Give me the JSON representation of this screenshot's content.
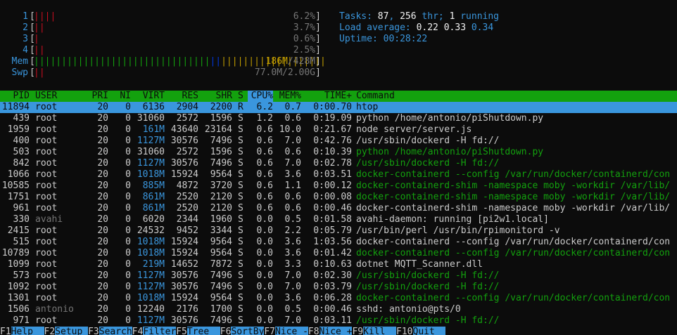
{
  "meters": {
    "cpus": [
      {
        "label": "1",
        "bars_red": "||||",
        "bars_green": "",
        "value": "6.2%"
      },
      {
        "label": "2",
        "bars_red": "||",
        "bars_green": "",
        "value": "3.7%"
      },
      {
        "label": "3",
        "bars_red": "|",
        "bars_green": "",
        "value": "0.6%"
      },
      {
        "label": "4",
        "bars_red": "||",
        "bars_green": "",
        "value": "2.5%"
      }
    ],
    "mem": {
      "label": "Mem",
      "bars_green": "||||||||||||||||||||||||||||||||",
      "bars_blue": "||",
      "bars_yellow": "|||||||||||||||||||",
      "value_used": "186M",
      "value_total": "/428M"
    },
    "swp": {
      "label": "Swp",
      "bars_red": "||",
      "value": "77.0M/2.00G"
    }
  },
  "summary": {
    "tasks_label": "Tasks: ",
    "tasks_count": "87",
    "tasks_sep": ", ",
    "threads": "256",
    "threads_label": " thr; ",
    "running": "1",
    "running_label": " running",
    "load_label": "Load average: ",
    "load1": "0.22",
    "load5": "0.33",
    "load15": "0.34",
    "uptime_label": "Uptime: ",
    "uptime": "00:28:22"
  },
  "columns": {
    "pid": "PID",
    "user": "USER",
    "pri": "PRI",
    "ni": "NI",
    "virt": "VIRT",
    "res": "RES",
    "shr": "SHR",
    "s": "S",
    "cpu": "CPU%",
    "mem": "MEM%",
    "time": "TIME+",
    "command": "Command"
  },
  "processes": [
    {
      "pid": "11894",
      "user": "root",
      "pri": "20",
      "ni": "0",
      "virt": "6136",
      "res": "2904",
      "shr": "2200",
      "s": "R",
      "cpu": "6.2",
      "mem": "0.7",
      "time": "0:00.70",
      "command": "htop",
      "kind": "sel"
    },
    {
      "pid": "439",
      "user": "root",
      "pri": "20",
      "ni": "0",
      "virt": "31060",
      "res": "2572",
      "shr": "1596",
      "s": "S",
      "cpu": "1.2",
      "mem": "0.6",
      "time": "0:19.09",
      "command": "python /home/antonio/piShutdown.py",
      "kind": "proc"
    },
    {
      "pid": "1959",
      "user": "root",
      "pri": "20",
      "ni": "0",
      "virt": "161M",
      "res": "43640",
      "shr": "23164",
      "s": "S",
      "cpu": "0.6",
      "mem": "10.0",
      "time": "0:21.67",
      "command": "node server/server.js",
      "kind": "proc"
    },
    {
      "pid": "400",
      "user": "root",
      "pri": "20",
      "ni": "0",
      "virt": "1127M",
      "res": "30576",
      "shr": "7496",
      "s": "S",
      "cpu": "0.6",
      "mem": "7.0",
      "time": "0:42.76",
      "command": "/usr/sbin/dockerd -H fd://",
      "kind": "proc"
    },
    {
      "pid": "503",
      "user": "root",
      "pri": "20",
      "ni": "0",
      "virt": "31060",
      "res": "2572",
      "shr": "1596",
      "s": "S",
      "cpu": "0.6",
      "mem": "0.6",
      "time": "0:10.39",
      "command": "python /home/antonio/piShutdown.py",
      "kind": "thread"
    },
    {
      "pid": "842",
      "user": "root",
      "pri": "20",
      "ni": "0",
      "virt": "1127M",
      "res": "30576",
      "shr": "7496",
      "s": "S",
      "cpu": "0.6",
      "mem": "7.0",
      "time": "0:02.78",
      "command": "/usr/sbin/dockerd -H fd://",
      "kind": "thread"
    },
    {
      "pid": "1066",
      "user": "root",
      "pri": "20",
      "ni": "0",
      "virt": "1018M",
      "res": "15924",
      "shr": "9564",
      "s": "S",
      "cpu": "0.6",
      "mem": "3.6",
      "time": "0:03.51",
      "command": "docker-containerd --config /var/run/docker/containerd/con",
      "kind": "thread"
    },
    {
      "pid": "10585",
      "user": "root",
      "pri": "20",
      "ni": "0",
      "virt": "885M",
      "res": "4872",
      "shr": "3720",
      "s": "S",
      "cpu": "0.6",
      "mem": "1.1",
      "time": "0:00.12",
      "command": "docker-containerd-shim -namespace moby -workdir /var/lib/",
      "kind": "thread"
    },
    {
      "pid": "1751",
      "user": "root",
      "pri": "20",
      "ni": "0",
      "virt": "861M",
      "res": "2520",
      "shr": "2120",
      "s": "S",
      "cpu": "0.6",
      "mem": "0.6",
      "time": "0:00.08",
      "command": "docker-containerd-shim -namespace moby -workdir /var/lib/",
      "kind": "thread"
    },
    {
      "pid": "961",
      "user": "root",
      "pri": "20",
      "ni": "0",
      "virt": "861M",
      "res": "2520",
      "shr": "2120",
      "s": "S",
      "cpu": "0.6",
      "mem": "0.6",
      "time": "0:00.46",
      "command": "docker-containerd-shim -namespace moby -workdir /var/lib/",
      "kind": "proc"
    },
    {
      "pid": "330",
      "user": "avahi",
      "pri": "20",
      "ni": "0",
      "virt": "6020",
      "res": "2344",
      "shr": "1960",
      "s": "S",
      "cpu": "0.0",
      "mem": "0.5",
      "time": "0:01.58",
      "command": "avahi-daemon: running [pi2w1.local]",
      "kind": "proc",
      "usergrey": true
    },
    {
      "pid": "2415",
      "user": "root",
      "pri": "20",
      "ni": "0",
      "virt": "24532",
      "res": "9452",
      "shr": "3344",
      "s": "S",
      "cpu": "0.0",
      "mem": "2.2",
      "time": "0:05.79",
      "command": "/usr/bin/perl /usr/bin/rpimonitord -v",
      "kind": "proc"
    },
    {
      "pid": "515",
      "user": "root",
      "pri": "20",
      "ni": "0",
      "virt": "1018M",
      "res": "15924",
      "shr": "9564",
      "s": "S",
      "cpu": "0.0",
      "mem": "3.6",
      "time": "1:03.56",
      "command": "docker-containerd --config /var/run/docker/containerd/con",
      "kind": "proc"
    },
    {
      "pid": "10789",
      "user": "root",
      "pri": "20",
      "ni": "0",
      "virt": "1018M",
      "res": "15924",
      "shr": "9564",
      "s": "S",
      "cpu": "0.0",
      "mem": "3.6",
      "time": "0:01.42",
      "command": "docker-containerd --config /var/run/docker/containerd/con",
      "kind": "thread"
    },
    {
      "pid": "1099",
      "user": "root",
      "pri": "20",
      "ni": "0",
      "virt": "219M",
      "res": "14652",
      "shr": "7872",
      "s": "S",
      "cpu": "0.0",
      "mem": "3.3",
      "time": "0:10.63",
      "command": "dotnet MQTT_Scanner.dll",
      "kind": "proc"
    },
    {
      "pid": "573",
      "user": "root",
      "pri": "20",
      "ni": "0",
      "virt": "1127M",
      "res": "30576",
      "shr": "7496",
      "s": "S",
      "cpu": "0.0",
      "mem": "7.0",
      "time": "0:02.30",
      "command": "/usr/sbin/dockerd -H fd://",
      "kind": "thread"
    },
    {
      "pid": "1092",
      "user": "root",
      "pri": "20",
      "ni": "0",
      "virt": "1127M",
      "res": "30576",
      "shr": "7496",
      "s": "S",
      "cpu": "0.0",
      "mem": "7.0",
      "time": "0:03.79",
      "command": "/usr/sbin/dockerd -H fd://",
      "kind": "thread"
    },
    {
      "pid": "1301",
      "user": "root",
      "pri": "20",
      "ni": "0",
      "virt": "1018M",
      "res": "15924",
      "shr": "9564",
      "s": "S",
      "cpu": "0.0",
      "mem": "3.6",
      "time": "0:06.28",
      "command": "docker-containerd --config /var/run/docker/containerd/con",
      "kind": "thread"
    },
    {
      "pid": "1506",
      "user": "antonio",
      "pri": "20",
      "ni": "0",
      "virt": "12240",
      "res": "2176",
      "shr": "1700",
      "s": "S",
      "cpu": "0.0",
      "mem": "0.5",
      "time": "0:00.46",
      "command": "sshd: antonio@pts/0",
      "kind": "proc",
      "usergrey": true
    },
    {
      "pid": "971",
      "user": "root",
      "pri": "20",
      "ni": "0",
      "virt": "1127M",
      "res": "30576",
      "shr": "7496",
      "s": "S",
      "cpu": "0.0",
      "mem": "7.0",
      "time": "0:03.11",
      "command": "/usr/sbin/dockerd -H fd://",
      "kind": "thread"
    }
  ],
  "footer": [
    {
      "key": "F1",
      "label": "Help  "
    },
    {
      "key": "F2",
      "label": "Setup "
    },
    {
      "key": "F3",
      "label": "Search"
    },
    {
      "key": "F4",
      "label": "Filter"
    },
    {
      "key": "F5",
      "label": "Tree  "
    },
    {
      "key": "F6",
      "label": "SortBy"
    },
    {
      "key": "F7",
      "label": "Nice -"
    },
    {
      "key": "F8",
      "label": "Nice +"
    },
    {
      "key": "F9",
      "label": "Kill  "
    },
    {
      "key": "F10",
      "label": "Quit  "
    }
  ],
  "colors": {
    "thread_green": "#13a10e",
    "selection": "#3a96dd",
    "header_bar": "#13a10e",
    "meter_cyan": "#3a96dd"
  }
}
